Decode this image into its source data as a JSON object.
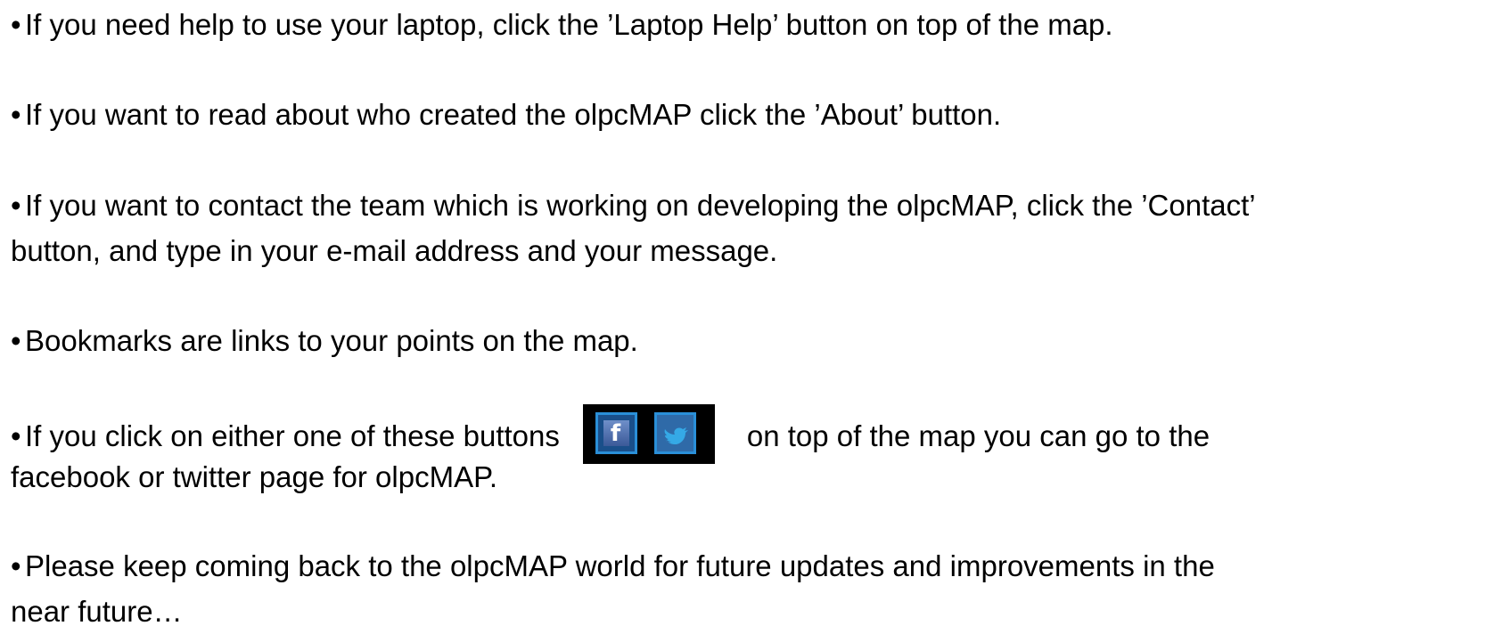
{
  "bullet_char": "•",
  "paragraphs": {
    "p1": {
      "line1": "If you need help to use your laptop, click the ’Laptop Help’ button on top of  the map."
    },
    "p2": {
      "line1": "If you want to read about who created the olpcMAP click the ’About’ button."
    },
    "p3": {
      "line1": "If you want to contact the team which is working on developing the olpcMAP, click the ’Contact’",
      "line2": "button, and type in your e-mail address and your message."
    },
    "p4": {
      "line1": "Bookmarks are links to your points on the map."
    },
    "p5": {
      "line1_before": "If you click on either one of these buttons",
      "line1_after": "on top of the map you can go to the",
      "line2": "facebook or twitter page for olpcMAP."
    },
    "p6": {
      "line1": "Please keep coming back to the olpcMAP world for future updates and improvements in the",
      "line2": "near future…"
    }
  },
  "social_buttons": {
    "facebook_icon": "facebook-icon",
    "facebook_glyph": "f",
    "twitter_icon": "twitter-bird-icon"
  },
  "colors": {
    "text": "#000000",
    "background": "#ffffff",
    "button_group_bg": "#000000",
    "button_border": "#2a8fd8",
    "facebook_blue": "#3b5998",
    "twitter_blue": "#35a9e6"
  }
}
